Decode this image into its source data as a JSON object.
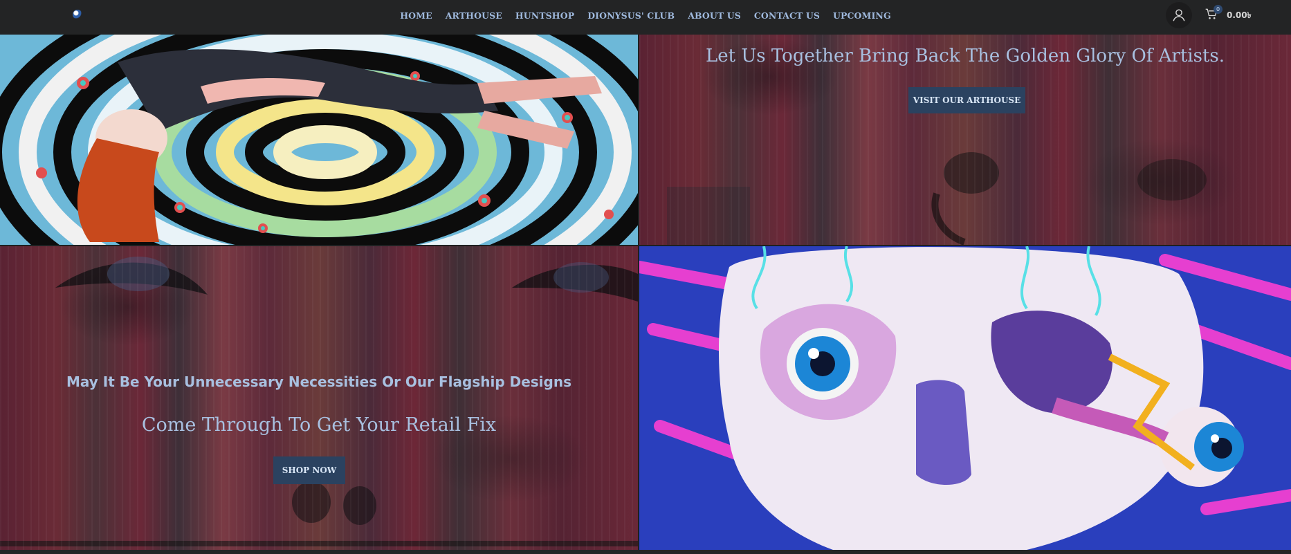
{
  "nav": {
    "items": [
      "HOME",
      "ARTHOUSE",
      "HUNTSHOP",
      "DIONYSUS' CLUB",
      "ABOUT US",
      "CONTACT US",
      "UPCOMING"
    ]
  },
  "cart": {
    "count": "0",
    "total": "0.00৳"
  },
  "hero_right": {
    "headline": "Let Us Together Bring Back The Golden Glory Of Artists.",
    "button": "VISIT OUR ARTHOUSE"
  },
  "shop_panel": {
    "subheadline": "May It Be Your Unnecessary Necessities Or Our Flagship Designs",
    "headline": "Come Through To Get Your Retail Fix",
    "button": "SHOP NOW"
  },
  "colors": {
    "header_bg": "#232425",
    "nav_text": "#9fb9dd",
    "button_bg": "#2b4260",
    "headline_text": "#a8c0e0"
  }
}
